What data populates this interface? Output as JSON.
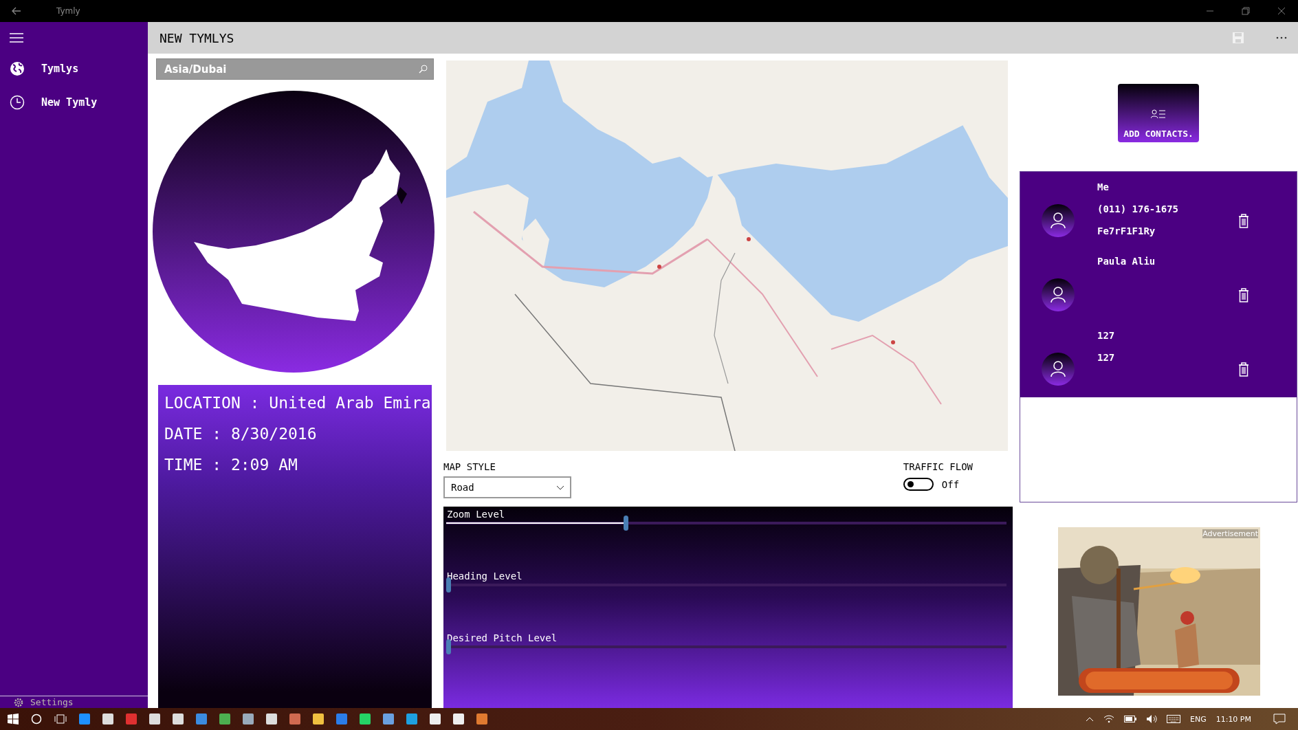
{
  "window": {
    "title": "Tymly"
  },
  "sidebar": {
    "items": [
      {
        "label": "Tymlys",
        "kind": "globe"
      },
      {
        "label": "New Tymly",
        "kind": "clock"
      }
    ],
    "footer": "Settings"
  },
  "page": {
    "title": "NEW TYMLYS"
  },
  "search": {
    "value": "Asia/Dubai"
  },
  "location_card": {
    "lines": [
      "LOCATION : United Arab Emira",
      "DATE : 8/30/2016",
      "TIME : 2:09 AM"
    ]
  },
  "map_style": {
    "label": "MAP STYLE",
    "value": "Road"
  },
  "traffic_flow": {
    "label": "TRAFFIC FLOW",
    "on": false,
    "state_text": "Off"
  },
  "sliders": [
    {
      "label": "Zoom Level",
      "level": 0.32
    },
    {
      "label": "Heading Level",
      "level": 0
    },
    {
      "label": "Desired Pitch Level",
      "level": 0
    }
  ],
  "add_contacts": {
    "label": "ADD CONTACTS."
  },
  "contacts": [
    {
      "lines": [
        "Me",
        "(011) 176-1675",
        "Fe7rF1F1Ry"
      ]
    },
    {
      "lines": [
        "Paula Aliu"
      ]
    },
    {
      "lines": [
        "127",
        "127"
      ]
    }
  ],
  "advertisement": {
    "label": "Advertisement"
  },
  "taskbar": {
    "language": "ENG",
    "time": "11:10 PM"
  }
}
